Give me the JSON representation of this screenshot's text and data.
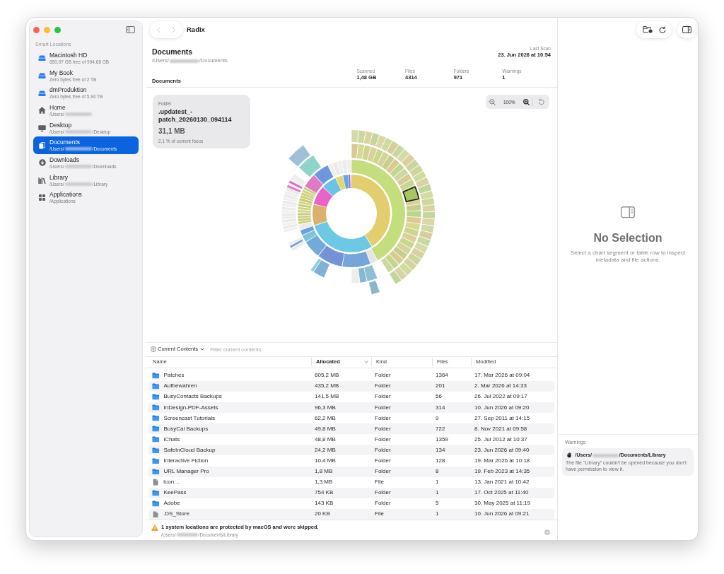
{
  "window": {
    "title": "Radix"
  },
  "toolbar": {
    "back": {
      "disabled": true
    },
    "forward": {
      "disabled": true
    }
  },
  "sidebar": {
    "section": "Smart Locations",
    "items": [
      {
        "kind": "drive",
        "title": "Macintosh HD",
        "subtitle": "650,07 GB free of 994,66 GB",
        "redacted": false,
        "selected": false
      },
      {
        "kind": "drive",
        "title": "My Book",
        "subtitle": "Zero bytes free of 2 TB",
        "redacted": false,
        "selected": false
      },
      {
        "kind": "drive",
        "title": "dmProduktion",
        "subtitle": "Zero bytes free of 5,94 TB",
        "redacted": false,
        "selected": false
      },
      {
        "kind": "home",
        "title": "Home",
        "subtitle": "/Users/",
        "redacted": true,
        "selected": false
      },
      {
        "kind": "desktop",
        "title": "Desktop",
        "subtitle": "/Users/",
        "redacted": true,
        "subtitle_end": "/Desktop",
        "selected": false
      },
      {
        "kind": "documents",
        "title": "Documents",
        "subtitle": "/Users/",
        "redacted": true,
        "subtitle_end": "/Documents",
        "selected": true
      },
      {
        "kind": "downloads",
        "title": "Downloads",
        "subtitle": "/Users/",
        "redacted": true,
        "subtitle_end": "/Downloads",
        "selected": false
      },
      {
        "kind": "library",
        "title": "Library",
        "subtitle": "/Users/",
        "redacted": true,
        "subtitle_end": "/Library",
        "selected": false
      },
      {
        "kind": "applications",
        "title": "Applications",
        "subtitle": "/Applications",
        "redacted": false,
        "selected": false
      }
    ]
  },
  "header": {
    "title": "Documents",
    "path": "/Users/",
    "redacted": true,
    "path_end": "/Documents",
    "last_scan_label": "Last Scan",
    "last_scan": "23. Jun 2026 at 10:54",
    "focus": "Documents",
    "stats": [
      {
        "label": "Scanned",
        "value": "1,48 GB"
      },
      {
        "label": "Files",
        "value": "4314"
      },
      {
        "label": "Folders",
        "value": "971"
      },
      {
        "label": "Warnings",
        "value": "1"
      }
    ]
  },
  "sunburst": {
    "card": {
      "label": "Folder",
      "name": ".updatest_-patch_20260130_094114",
      "size": "31,1 MB",
      "share": "2,1 % of current focus"
    },
    "zoom_level": "100%"
  },
  "table": {
    "scope": "Current Contents",
    "filter_placeholder": "Filter current contents",
    "columns": [
      {
        "label": "Name",
        "sorted": false
      },
      {
        "label": "Allocated",
        "sorted": true
      },
      {
        "label": "Kind",
        "sorted": false
      },
      {
        "label": "Files",
        "sorted": false
      },
      {
        "label": "Modified",
        "sorted": false
      }
    ],
    "rows": [
      {
        "kind": "folder",
        "name": "Patches",
        "allocated": "605,2 MB",
        "type": "Folder",
        "files": "1364",
        "modified": "17. Mar 2026 at 09:04"
      },
      {
        "kind": "folder",
        "name": "Aufbewahren",
        "allocated": "435,2 MB",
        "type": "Folder",
        "files": "201",
        "modified": "2. Mar 2026 at 14:33"
      },
      {
        "kind": "folder",
        "name": "BusyContacts Backups",
        "allocated": "141,5 MB",
        "type": "Folder",
        "files": "56",
        "modified": "26. Jul 2022 at 09:17"
      },
      {
        "kind": "folder",
        "name": "InDesign-PDF-Assets",
        "allocated": "96,3 MB",
        "type": "Folder",
        "files": "314",
        "modified": "10. Jun 2026 at 09:20"
      },
      {
        "kind": "folder",
        "name": "Screencast Tutorials",
        "allocated": "62,2 MB",
        "type": "Folder",
        "files": "9",
        "modified": "27. Sep 2011 at 14:15"
      },
      {
        "kind": "folder",
        "name": "BusyCal Backups",
        "allocated": "49,8 MB",
        "type": "Folder",
        "files": "722",
        "modified": "8. Nov 2021 at 09:58"
      },
      {
        "kind": "folder",
        "name": "iChats",
        "allocated": "48,8 MB",
        "type": "Folder",
        "files": "1359",
        "modified": "25. Jul 2012 at 10:37"
      },
      {
        "kind": "folder",
        "name": "SafeInCloud Backup",
        "allocated": "24,2 MB",
        "type": "Folder",
        "files": "134",
        "modified": "23. Jun 2026 at 09:40"
      },
      {
        "kind": "folder",
        "name": "Interactive Fiction",
        "allocated": "10,4 MB",
        "type": "Folder",
        "files": "128",
        "modified": "19. Mar 2026 at 10:18"
      },
      {
        "kind": "folder",
        "name": "URL Manager Pro",
        "allocated": "1,8 MB",
        "type": "Folder",
        "files": "8",
        "modified": "19. Feb 2023 at 14:35"
      },
      {
        "kind": "file",
        "name": "Icon…",
        "allocated": "1,3 MB",
        "type": "File",
        "files": "1",
        "modified": "13. Jan 2021 at 10:42"
      },
      {
        "kind": "folder",
        "name": "KeePass",
        "allocated": "754 KB",
        "type": "Folder",
        "files": "1",
        "modified": "17. Oct 2025 at 11:40"
      },
      {
        "kind": "folder",
        "name": "Adobe",
        "allocated": "143 KB",
        "type": "Folder",
        "files": "5",
        "modified": "30. May 2025 at 11:19"
      },
      {
        "kind": "file",
        "name": ".DS_Store",
        "allocated": "20 KB",
        "type": "File",
        "files": "1",
        "modified": "10. Jun 2026 at 09:21"
      }
    ]
  },
  "footer": {
    "message": "1 system locations are protected by macOS and were skipped.",
    "path": "/Users/",
    "redacted": true,
    "path_end": "/Documents/Library"
  },
  "inspector": {
    "title": "No Selection",
    "text": "Select a chart segment or table row to inspect metadata and file actions.",
    "warnings_label": "Warnings",
    "warnings": [
      {
        "path": "/Users/",
        "redacted": true,
        "path_end": "/Documents/Library",
        "message": "The file “Library” couldn’t be opened because you don’t have permission to view it."
      }
    ]
  }
}
